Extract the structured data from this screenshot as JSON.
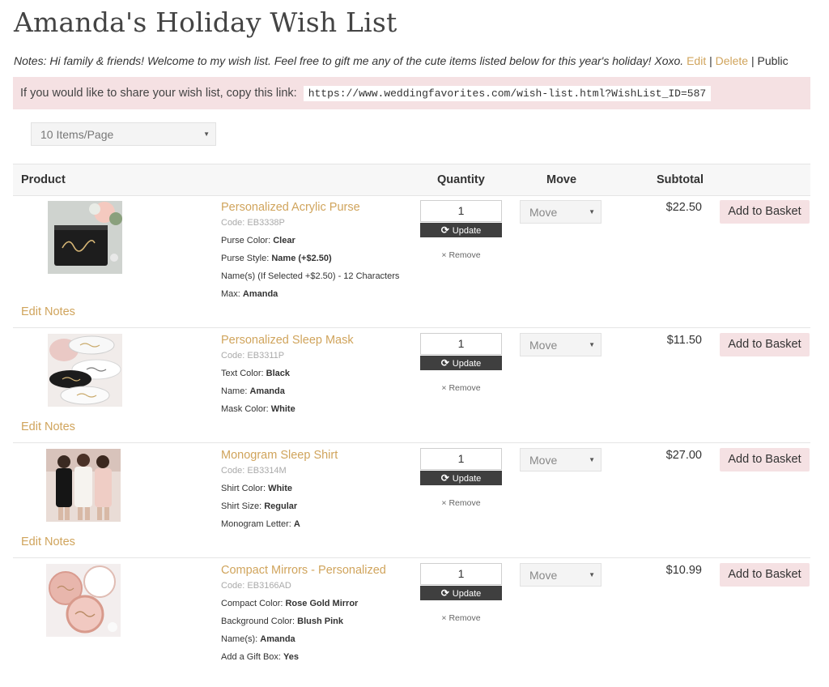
{
  "title": "Amanda's Holiday Wish List",
  "notes": {
    "text": "Notes: Hi family & friends! Welcome to my wish list. Feel free to gift me any of the cute items listed below for this year's holiday! Xoxo.",
    "edit_label": "Edit",
    "delete_label": "Delete",
    "separator": "|",
    "visibility": "Public"
  },
  "share": {
    "prompt": "If you would like to share your wish list, copy this link:",
    "url": "https://www.weddingfavorites.com/wish-list.html?WishList_ID=587"
  },
  "per_page": {
    "selected": "10 Items/Page"
  },
  "table_headers": {
    "product": "Product",
    "quantity": "Quantity",
    "move": "Move",
    "subtotal": "Subtotal"
  },
  "row_labels": {
    "update": "Update",
    "remove": "× Remove",
    "move_placeholder": "Move",
    "add_to_basket": "Add to Basket",
    "edit_notes": "Edit Notes"
  },
  "products": [
    {
      "name": "Personalized Acrylic Purse",
      "code": "Code: EB3338P",
      "options": [
        {
          "label": "Purse Color: ",
          "value": "Clear"
        },
        {
          "label": "Purse Style: ",
          "value": "Name (+$2.50)"
        },
        {
          "label": "Name(s) (If Selected +$2.50) - 12 Characters",
          "value": ""
        },
        {
          "label": "Max: ",
          "value": "Amanda"
        }
      ],
      "quantity": "1",
      "subtotal": "$22.50"
    },
    {
      "name": "Personalized Sleep Mask",
      "code": "Code: EB3311P",
      "options": [
        {
          "label": "Text Color: ",
          "value": "Black"
        },
        {
          "label": "Name: ",
          "value": "Amanda"
        },
        {
          "label": "Mask Color: ",
          "value": "White"
        }
      ],
      "quantity": "1",
      "subtotal": "$11.50"
    },
    {
      "name": "Monogram Sleep Shirt",
      "code": "Code: EB3314M",
      "options": [
        {
          "label": "Shirt Color: ",
          "value": "White"
        },
        {
          "label": "Shirt Size: ",
          "value": "Regular"
        },
        {
          "label": "Monogram Letter: ",
          "value": "A"
        }
      ],
      "quantity": "1",
      "subtotal": "$27.00"
    },
    {
      "name": "Compact Mirrors - Personalized",
      "code": "Code: EB3166AD",
      "options": [
        {
          "label": "Compact Color: ",
          "value": "Rose Gold Mirror"
        },
        {
          "label": "Background Color: ",
          "value": "Blush Pink"
        },
        {
          "label": "Name(s): ",
          "value": "Amanda"
        },
        {
          "label": "Add a Gift Box: ",
          "value": "Yes"
        }
      ],
      "quantity": "1",
      "subtotal": "$10.99"
    }
  ],
  "colors": {
    "accent_gold": "#d0a45c",
    "share_bg": "#f5e1e3",
    "update_btn": "#3f3f3f"
  }
}
